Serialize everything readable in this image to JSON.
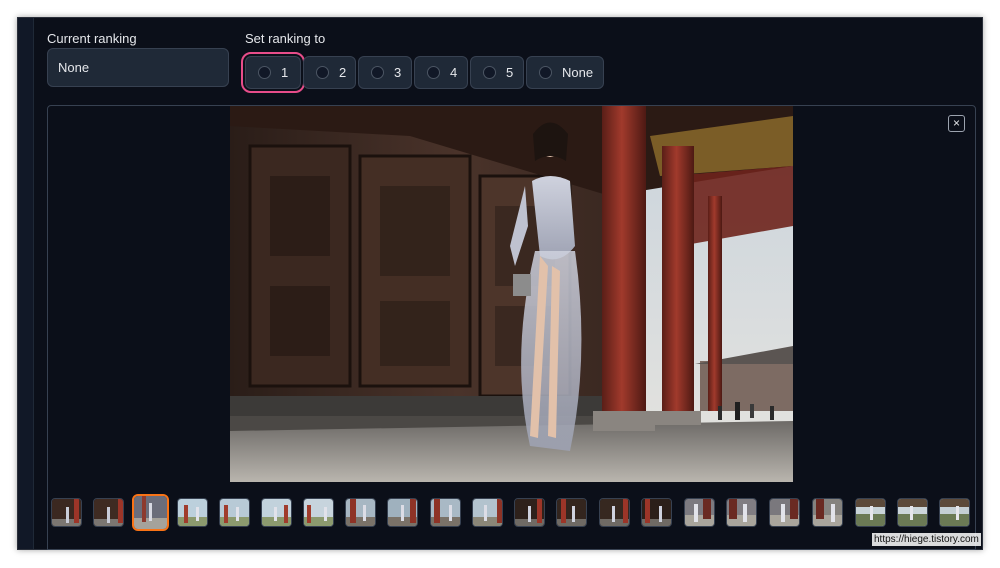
{
  "current_ranking": {
    "label": "Current ranking",
    "value": "None"
  },
  "set_ranking": {
    "label": "Set ranking to",
    "options": [
      "1",
      "2",
      "3",
      "4",
      "5",
      "None"
    ],
    "highlighted": "1"
  },
  "gallery": {
    "close_icon": "close-icon",
    "close_glyph": "×",
    "selected_thumbnail": 3,
    "thumbnail_count": 22
  },
  "watermark": "https://hiege.tistory.com",
  "colors": {
    "background": "#0b0f19",
    "highlight_pink": "#e84d8a",
    "selected_orange": "#f97316"
  }
}
